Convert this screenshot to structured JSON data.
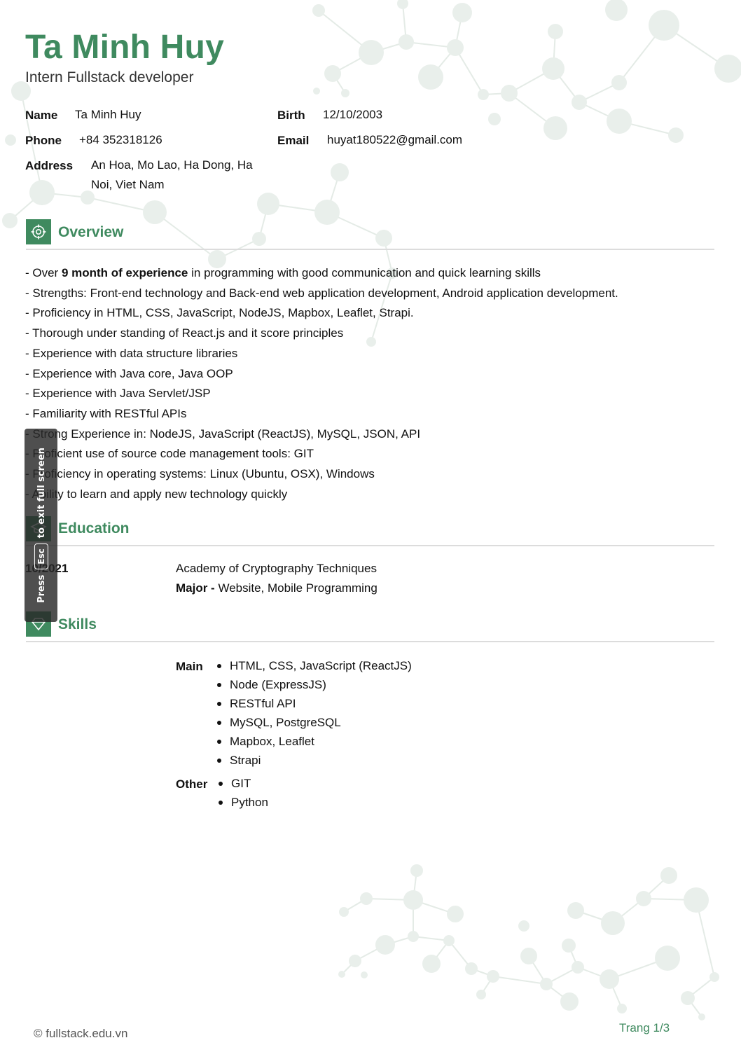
{
  "header": {
    "name": "Ta Minh Huy",
    "job_title": "Intern Fullstack developer"
  },
  "personal_info": {
    "name_label": "Name",
    "name_value": "Ta Minh Huy",
    "birth_label": "Birth",
    "birth_value": "12/10/2003",
    "phone_label": "Phone",
    "phone_value": "+84 352318126",
    "email_label": "Email",
    "email_value": "huyat180522@gmail.com",
    "address_label": "Address",
    "address_line1": "An Hoa, Mo Lao, Ha Dong, Ha",
    "address_line2": "Noi, Viet Nam"
  },
  "overview": {
    "title": "Overview",
    "icon": "target-icon",
    "first_prefix": "- Over ",
    "first_bold": "9 month of experience",
    "first_suffix": " in programming with good communication and quick learning skills",
    "items": [
      "- Strengths: Front-end technology and Back-end web application development, Android application development.",
      "- Proficiency in HTML, CSS, JavaScript, NodeJS, Mapbox, Leaflet, Strapi.",
      "- Thorough under standing of React.js and it score principles",
      "- Experience with data structure libraries",
      "- Experience with Java core, Java OOP",
      "- Experience with Java Servlet/JSP",
      "- Familiarity with RESTful APIs",
      "- Strong Experience in: NodeJS, JavaScript (ReactJS), MySQL, JSON, API",
      "- Proficient use of source code management tools: GIT",
      "- Proficiency in operating systems: Linux (Ubuntu, OSX), Windows",
      "- Ability to learn and apply new technology quickly"
    ]
  },
  "education": {
    "title": "Education",
    "icon": "graduation-cap-icon",
    "date": "10/2021",
    "school": "Academy of Cryptography Techniques",
    "major_label": "Major - ",
    "major_value": "Website, Mobile Programming"
  },
  "skills": {
    "title": "Skills",
    "icon": "diamond-icon",
    "main_label": "Main",
    "main_items": [
      "HTML, CSS, JavaScript (ReactJS)",
      "Node (ExpressJS)",
      "RESTful API",
      "MySQL, PostgreSQL",
      "Mapbox, Leaflet",
      "Strapi"
    ],
    "other_label": "Other",
    "other_items": [
      "GIT",
      "Python"
    ]
  },
  "footer": {
    "copyright": "© fullstack.edu.vn",
    "page_label": "Trang  1/3"
  },
  "overlay": {
    "press": "Press",
    "key": "Esc",
    "message": "to exit full screen"
  },
  "colors": {
    "accent": "#3f8a5f",
    "decor": "#e9efeb"
  }
}
